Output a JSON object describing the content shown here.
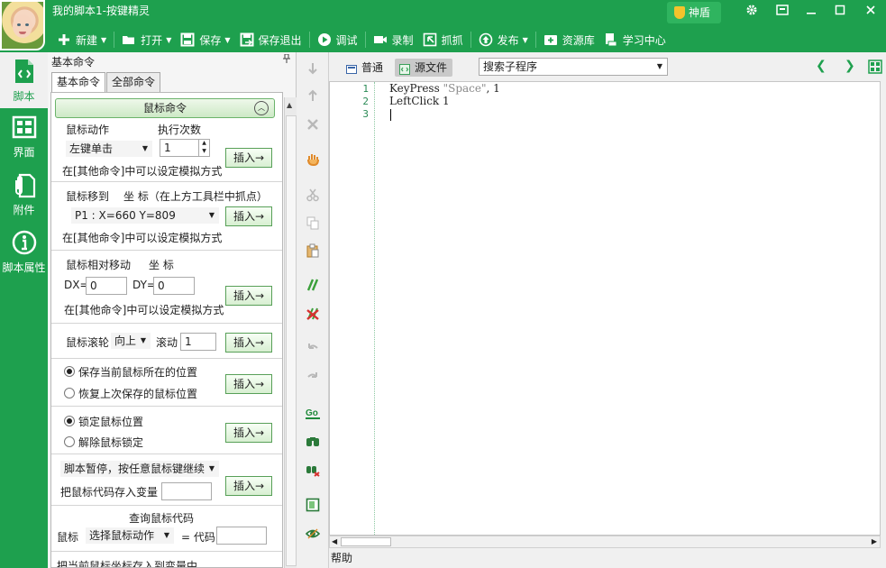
{
  "app": {
    "title": "我的脚本1-按键精灵",
    "shield_label": "神盾",
    "window_controls": [
      "settings-icon",
      "skin-icon",
      "minimize-icon",
      "maximize-icon",
      "close-icon"
    ]
  },
  "toolbar": {
    "items": [
      {
        "label": "新建",
        "icon": "plus-icon",
        "dropdown": true
      },
      {
        "label": "打开",
        "icon": "folder-icon",
        "dropdown": true
      },
      {
        "label": "保存",
        "icon": "save-icon",
        "dropdown": true
      },
      {
        "label": "保存退出",
        "icon": "save-exit-icon",
        "dropdown": false
      },
      {
        "label": "调试",
        "icon": "play-icon",
        "dropdown": false
      },
      {
        "label": "录制",
        "icon": "camera-icon",
        "dropdown": false
      },
      {
        "label": "抓抓",
        "icon": "capture-icon",
        "dropdown": false
      },
      {
        "label": "发布",
        "icon": "publish-icon",
        "dropdown": true
      },
      {
        "label": "资源库",
        "icon": "library-icon",
        "dropdown": false
      },
      {
        "label": "学习中心",
        "icon": "learn-icon",
        "dropdown": false
      }
    ]
  },
  "leftnav": {
    "items": [
      {
        "label": "脚本",
        "icon": "script-icon",
        "active": true
      },
      {
        "label": "界面",
        "icon": "layout-icon",
        "active": false
      },
      {
        "label": "附件",
        "icon": "attachment-icon",
        "active": false
      },
      {
        "label": "脚本属性",
        "icon": "info-icon",
        "active": false
      }
    ]
  },
  "panel": {
    "title": "基本命令",
    "tabs": [
      "基本命令",
      "全部命令"
    ],
    "section_title": "鼠标命令",
    "insert_label": "插入→",
    "mouse_action": {
      "label": "鼠标动作",
      "count_label": "执行次数",
      "action_value": "左键单击",
      "count_value": "1",
      "hint": "在[其他命令]中可以设定模拟方式"
    },
    "mouse_move": {
      "label": "鼠标移到",
      "coord_label": "坐 标（在上方工具栏中抓点）",
      "point_value": "P1 : X=660 Y=809",
      "hint": "在[其他命令]中可以设定模拟方式"
    },
    "mouse_relative": {
      "label": "鼠标相对移动",
      "coord_label": "坐 标",
      "dx_label": "DX=",
      "dx_value": "0",
      "dy_label": "DY=",
      "dy_value": "0",
      "hint": "在[其他命令]中可以设定模拟方式"
    },
    "mouse_wheel": {
      "label": "鼠标滚轮",
      "direction_value": "向上",
      "scroll_label": "滚动",
      "scroll_value": "1"
    },
    "save_pos": {
      "option_save": "保存当前鼠标所在的位置",
      "option_restore": "恢复上次保存的鼠标位置",
      "selected": "save"
    },
    "lock": {
      "option_lock": "锁定鼠标位置",
      "option_unlock": "解除鼠标锁定",
      "selected": "lock"
    },
    "pause": {
      "pause_value": "脚本暂停，按任意鼠标键继续",
      "store_label": "把鼠标代码存入变量",
      "store_value": ""
    },
    "query": {
      "title": "查询鼠标代码",
      "mouse_label": "鼠标",
      "action_value": "选择鼠标动作",
      "code_label": "= 代码",
      "code_value": ""
    },
    "cut_line": "把当前鼠标坐标存入到变量中"
  },
  "midtools": [
    "down-arrow-icon",
    "up-arrow-icon",
    "delete-icon",
    "hand-icon",
    "cut-icon",
    "copy-icon",
    "paste-icon",
    "comment-icon",
    "uncomment-icon",
    "undo-icon",
    "redo-icon",
    "go-icon",
    "find-icon",
    "replace-icon",
    "script-debug-icon",
    "view-icon"
  ],
  "editor": {
    "tabs": [
      {
        "label": "普通",
        "icon": "normal-view-icon",
        "active": false
      },
      {
        "label": "源文件",
        "icon": "source-icon",
        "active": true
      }
    ],
    "search_value": "搜索子程序",
    "lines": [
      {
        "num": "1",
        "parts": [
          {
            "t": "KeyPress ",
            "s": false
          },
          {
            "t": "\"Space\"",
            "s": true
          },
          {
            "t": ", 1",
            "s": false
          }
        ]
      },
      {
        "num": "2",
        "parts": [
          {
            "t": "LeftClick 1",
            "s": false
          }
        ]
      },
      {
        "num": "3",
        "parts": []
      }
    ]
  },
  "status": {
    "help": "帮助"
  },
  "colors": {
    "brand": "#1ea04e",
    "panel_bg": "#f5f5f5",
    "editor_bg": "#ffffff",
    "string": "#8a8a8a"
  }
}
